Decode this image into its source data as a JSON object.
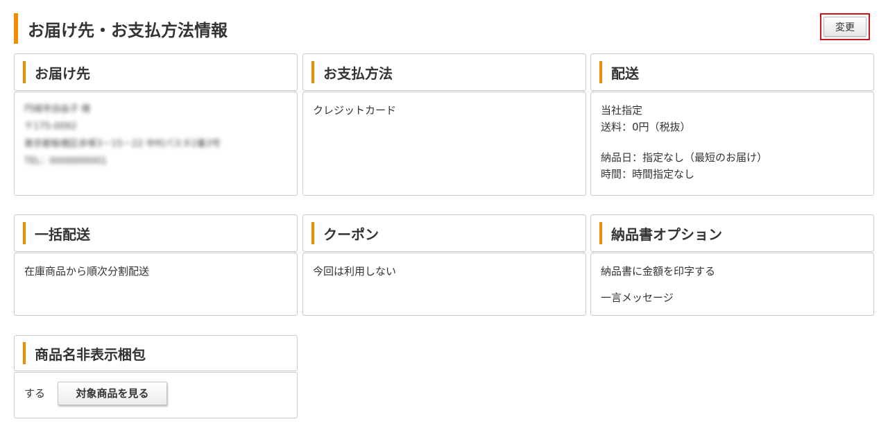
{
  "header": {
    "title": "お届け先・お支払方法情報",
    "change_button": "変更"
  },
  "panels": {
    "delivery_address": {
      "title": "お届け先",
      "lines": [
        "円城寺自由子 様",
        "〒175-0092",
        "東京都板橋区赤塚3－15－22 中村パスタ2番3号",
        "TEL：0000000001"
      ]
    },
    "payment": {
      "title": "お支払方法",
      "value": "クレジットカード"
    },
    "shipping": {
      "title": "配送",
      "method": "当社指定",
      "fee": "送料：0円（税抜）",
      "delivery_date": "納品日：指定なし（最短のお届け）",
      "time": "時間：時間指定なし"
    },
    "bulk_shipping": {
      "title": "一括配送",
      "value": "在庫商品から順次分割配送"
    },
    "coupon": {
      "title": "クーポン",
      "value": "今回は利用しない"
    },
    "invoice_option": {
      "title": "納品書オプション",
      "amount_print": "納品書に金額を印字する",
      "message": "一言メッセージ"
    },
    "hidden_name_packing": {
      "title": "商品名非表示梱包",
      "value": "する",
      "view_button": "対象商品を見る"
    }
  }
}
